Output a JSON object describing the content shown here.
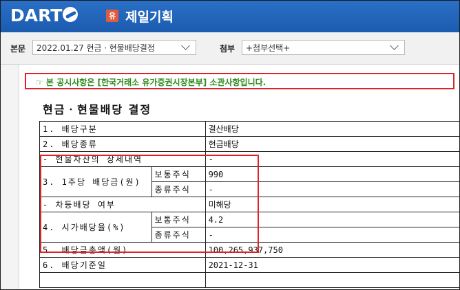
{
  "header": {
    "logo_text": "DART",
    "corp_badge": "유",
    "corp_name": "제일기획"
  },
  "toolbar": {
    "main_label": "본문",
    "main_select_value": "2022.01.27  현금ㆍ현물배당결정",
    "attach_label": "첨부",
    "attach_select_value": "+첨부선택+"
  },
  "notice": "☞ 본 공시사항은 [한국거래소 유가증권시장본부] 소관사항입니다.",
  "document": {
    "title": "현금ㆍ현물배당 결정",
    "rows": [
      {
        "label": "1. 배당구분",
        "value": "결산배당"
      },
      {
        "label": "2. 배당종류",
        "value": "현금배당"
      },
      {
        "label": "- 현물자산의 상세내역",
        "value": "-"
      },
      {
        "label": "3. 1주당 배당금(원)",
        "sub": [
          {
            "label": "보통주식",
            "value": "990"
          },
          {
            "label": "종류주식",
            "value": "-"
          }
        ]
      },
      {
        "label": "- 차등배당 여부",
        "value": "미해당"
      },
      {
        "label": "4. 시가배당율(%)",
        "sub": [
          {
            "label": "보통주식",
            "value": "4.2"
          },
          {
            "label": "종류주식",
            "value": "-"
          }
        ]
      },
      {
        "label": "5. 배당금총액(원)",
        "value": "100,265,937,750"
      },
      {
        "label": "6. 배당기준일",
        "value": "2021-12-31"
      }
    ]
  },
  "colors": {
    "header_blue": "#1f63b8",
    "notice_green": "#2e8b1e",
    "highlight_red": "#e1212a"
  }
}
